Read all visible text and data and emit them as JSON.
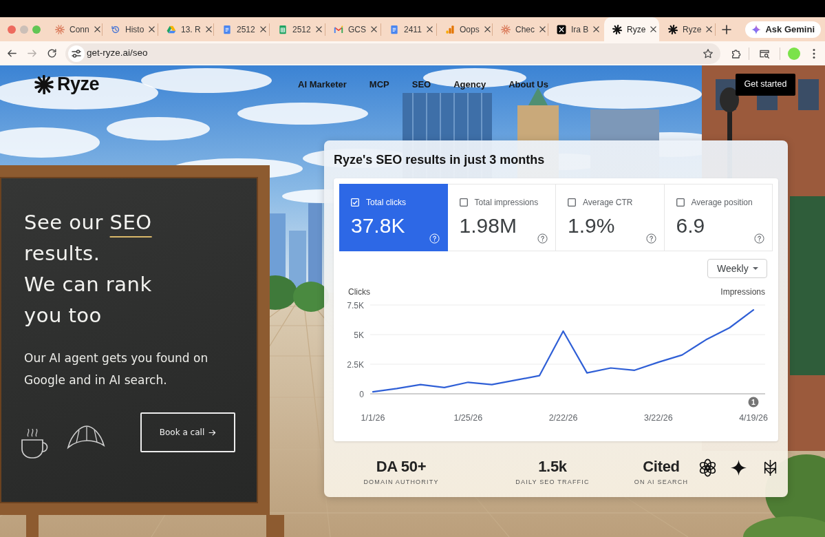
{
  "browser": {
    "tabs": [
      {
        "title": "Conn",
        "kind": "sunburst",
        "selected": false
      },
      {
        "title": "Histo",
        "kind": "history",
        "selected": false
      },
      {
        "title": "13. R",
        "kind": "triangle",
        "selected": false
      },
      {
        "title": "2512",
        "kind": "document",
        "selected": false
      },
      {
        "title": "2512",
        "kind": "spreadsheet",
        "selected": false
      },
      {
        "title": "GCS",
        "kind": "mail",
        "selected": false
      },
      {
        "title": "2411",
        "kind": "document",
        "selected": false
      },
      {
        "title": "Oops",
        "kind": "barchart",
        "selected": false
      },
      {
        "title": "Chec",
        "kind": "sunburst",
        "selected": false
      },
      {
        "title": "Ira B",
        "kind": "xmark",
        "selected": false
      },
      {
        "title": "Ryze",
        "kind": "asterisk",
        "selected": true
      },
      {
        "title": "Ryze",
        "kind": "asterisk",
        "selected": false
      }
    ],
    "ask_button": "Ask Gemini",
    "nav_buttons": [
      {
        "kind": "back",
        "disabled": false
      },
      {
        "kind": "forward",
        "disabled": true
      },
      {
        "kind": "reload",
        "disabled": false
      }
    ],
    "address": "get-ryze.ai/seo"
  },
  "site_nav": {
    "logo": "Ryze",
    "links": [
      "AI Marketer",
      "MCP",
      "SEO",
      "Agency",
      "About Us"
    ],
    "cta": "Get started"
  },
  "hero": {
    "heading_start": "See our",
    "heading_highlight": "SEO",
    "heading_end": "results.",
    "heading_second": "We can rank you too",
    "subtitle": "Our AI agent gets you found on Google and in AI search.",
    "button": "Book a call"
  },
  "results_card": {
    "title": "Ryze's SEO results in just 3 months",
    "metrics": [
      {
        "label": "Total clicks",
        "value": "37.8K",
        "checked": true
      },
      {
        "label": "Total impressions",
        "value": "1.98M",
        "checked": false
      },
      {
        "label": "Average CTR",
        "value": "1.9%",
        "checked": false
      },
      {
        "label": "Average position",
        "value": "6.9",
        "checked": false
      }
    ],
    "period": "Weekly",
    "right_axis_label": "Impressions",
    "chart_data": {
      "type": "line",
      "ylabel": "Clicks",
      "categories": [
        "1/1/26",
        null,
        null,
        null,
        "1/25/26",
        null,
        null,
        null,
        "2/22/26",
        null,
        null,
        null,
        "3/22/26",
        null,
        null,
        null,
        "4/19/26"
      ],
      "series": [
        {
          "color": "#2f5fd6",
          "values": [
            170,
            440,
            780,
            530,
            970,
            780,
            1150,
            1530,
            5290,
            1770,
            2180,
            1990,
            2670,
            3280,
            4560,
            5580,
            7090
          ]
        }
      ],
      "ylim": [
        0,
        7500
      ],
      "yticks": [
        {
          "value": 0,
          "label": "0"
        },
        {
          "value": 2500,
          "label": "2.5K"
        },
        {
          "value": 5000,
          "label": "5K"
        },
        {
          "value": 7500,
          "label": "7.5K"
        }
      ],
      "annotations": [
        "1"
      ]
    }
  },
  "stats": [
    {
      "value": "DA 50+",
      "label": "DOMAIN AUTHORITY"
    },
    {
      "value": "1.5k",
      "label": "DAILY SEO TRAFFIC"
    },
    {
      "value": "Cited",
      "label": "ON AI SEARCH"
    }
  ]
}
